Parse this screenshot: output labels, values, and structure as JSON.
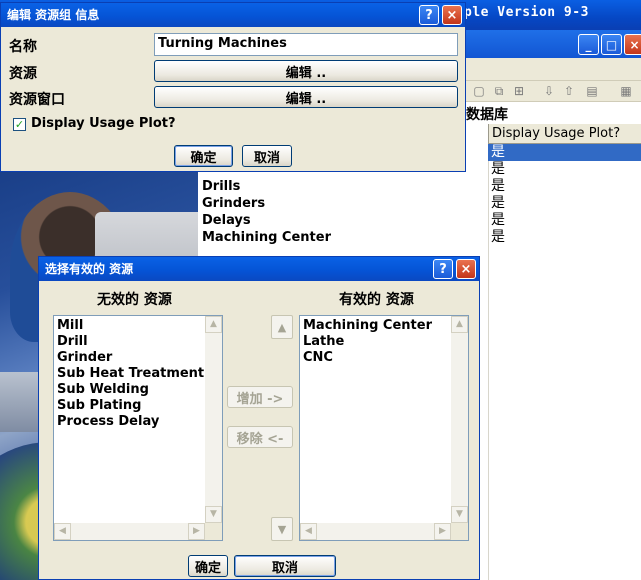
{
  "main_window": {
    "title": "ple Version 9-3",
    "db_header": "数据库",
    "column_header": "Display Usage Plot?",
    "names": [
      "Drills",
      "Grinders",
      "Delays",
      "Machining Center"
    ],
    "partial_name": "Turning Machines",
    "values": [
      "是",
      "是",
      "是",
      "是",
      "是",
      "是"
    ],
    "selected_value_index": 0
  },
  "edit_dialog": {
    "title": "编辑 资源组 信息",
    "name_label": "名称",
    "name_value": "Turning Machines",
    "resource_label": "资源",
    "resource_button": "编辑 ..",
    "resource_window_label": "资源窗口",
    "resource_window_button": "编辑 ..",
    "display_usage_label": "Display Usage Plot?",
    "display_usage_checked": true,
    "ok_label": "确定",
    "cancel_label": "取消"
  },
  "select_dialog": {
    "title": "选择有效的 资源",
    "inactive_header": "无效的 资源",
    "active_header": "有效的 资源",
    "inactive_items": [
      "Mill",
      "Drill",
      "Grinder",
      "Sub Heat Treatment",
      "Sub Welding",
      "Sub Plating",
      "Process Delay"
    ],
    "active_items": [
      "Machining Center",
      "Lathe",
      "CNC"
    ],
    "add_label": "增加 ->",
    "remove_label": "移除 <-",
    "ok_label": "确定",
    "cancel_label": "取消"
  },
  "colors": {
    "title_bar": "#0554d6",
    "selection": "#316ac5",
    "dialog_bg": "#ece9d8"
  }
}
